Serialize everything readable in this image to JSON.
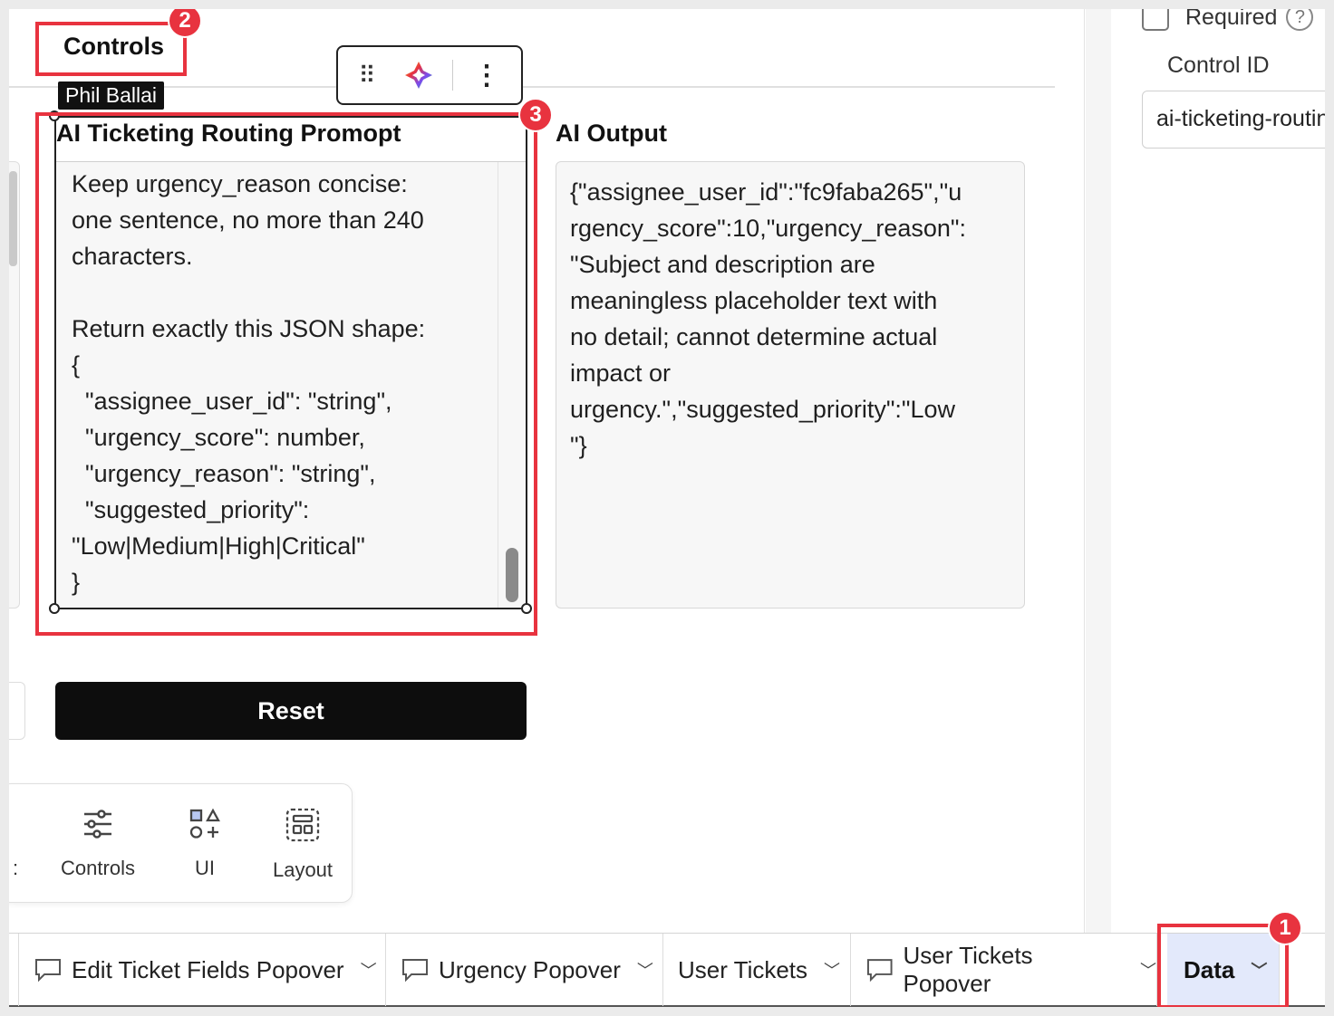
{
  "canvas": {
    "section_title": "Controls",
    "author_tag": "Phil Ballai",
    "prompt_control": {
      "label": "AI Ticketing Routing Promopt",
      "text": "Keep urgency_reason concise:\none sentence, no more than 240\ncharacters.\n\nReturn exactly this JSON shape:\n{\n  \"assignee_user_id\": \"string\",\n  \"urgency_score\": number,\n  \"urgency_reason\": \"string\",\n  \"suggested_priority\":\n\"Low|Medium|High|Critical\"\n}"
    },
    "output_control": {
      "label": "AI Output",
      "text": "{\"assignee_user_id\":\"fc9faba265\",\"u\nrgency_score\":10,\"urgency_reason\":\n\"Subject and description are\nmeaningless placeholder text with\nno detail; cannot determine actual\nimpact or\nurgency.\",\"suggested_priority\":\"Low\n\"}"
    },
    "reset_button": "Reset",
    "insert_panel": {
      "items": [
        {
          "label": "Controls",
          "icon": "sliders-icon"
        },
        {
          "label": "UI",
          "icon": "shapes-icon"
        },
        {
          "label": "Layout",
          "icon": "layout-grid-icon"
        }
      ]
    }
  },
  "properties": {
    "required_label": "Required",
    "help_symbol": "?",
    "control_id_label": "Control ID",
    "control_id_value": "ai-ticketing-routing-prompt"
  },
  "tabs": [
    {
      "label": "Edit Ticket Fields Popover",
      "icon": "popover-icon"
    },
    {
      "label": "Urgency Popover",
      "icon": "popover-icon"
    },
    {
      "label": "User Tickets",
      "icon": ""
    },
    {
      "label": "User Tickets Popover",
      "icon": "popover-icon"
    },
    {
      "label": "Data",
      "icon": "",
      "active": true
    }
  ],
  "annotations": [
    "1",
    "2",
    "3"
  ],
  "colors": {
    "annotation": "#e8333f",
    "active_tab_bg": "#e3e9fb",
    "reset_button_bg": "#0d0d0d"
  }
}
